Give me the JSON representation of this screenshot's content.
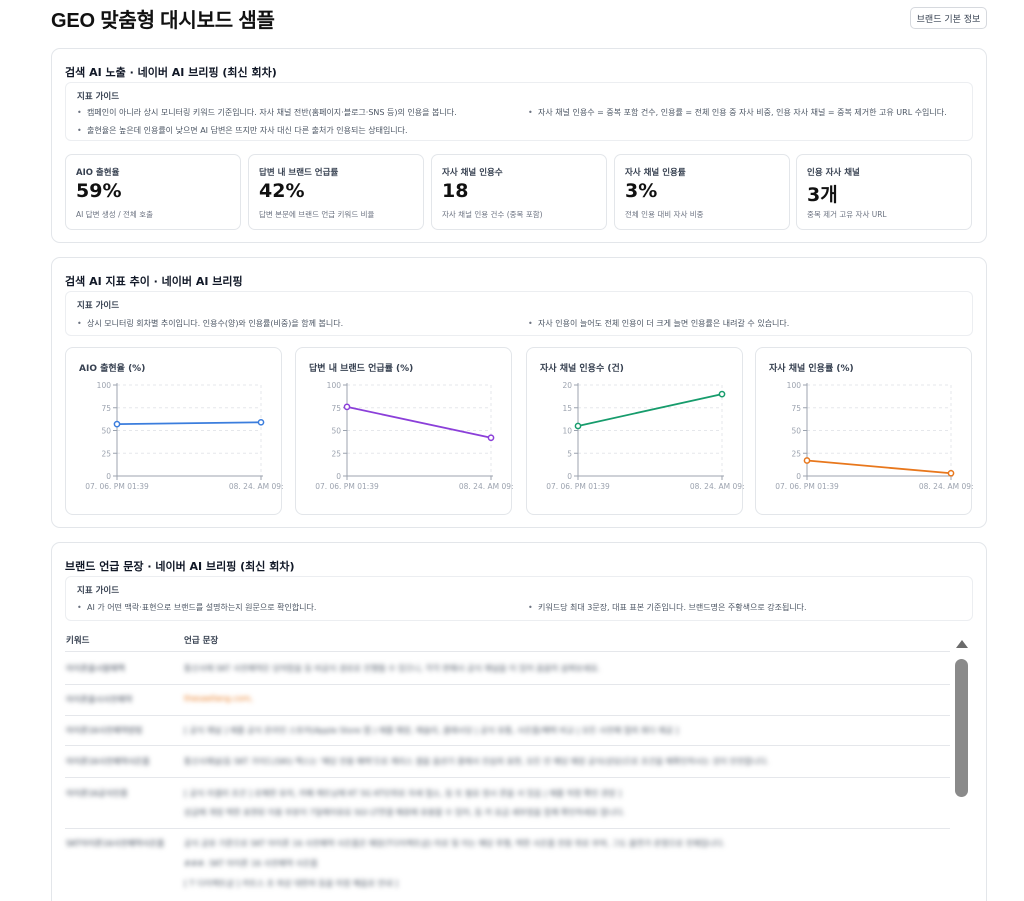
{
  "page": {
    "title": "GEO 맞춤형 대시보드 샘플",
    "brand_button": "브랜드 기본 정보"
  },
  "section1": {
    "title": "검색 AI 노출 · 네이버 AI 브리핑 (최신 회차)",
    "guide_title": "지표 가이드",
    "guide_items": [
      "캠페인이 아니라 상시 모니터링 키워드 기준입니다. 자사 채널 전반(홈페이지·블로그·SNS 등)의 인용을 봅니다.",
      "자사 채널 인용수 = 중복 포함 건수, 인용률 = 전체 인용 중 자사 비중, 인용 자사 채널 = 중복 제거한 고유 URL 수입니다.",
      "출현율은 높은데 인용률이 낮으면 AI 답변은 뜨지만 자사 대신 다른 출처가 인용되는 상태입니다."
    ],
    "metrics": [
      {
        "label": "AIO 출현율",
        "value": "59%",
        "sub": "AI 답변 생성 / 전체 호출"
      },
      {
        "label": "답변 내 브랜드 언급률",
        "value": "42%",
        "sub": "답변 본문에 브랜드 언급 키워드 비율"
      },
      {
        "label": "자사 채널 인용수",
        "value": "18",
        "sub": "자사 채널 인용 건수 (중복 포함)"
      },
      {
        "label": "자사 채널 인용률",
        "value": "3%",
        "sub": "전체 인용 대비 자사 비중"
      },
      {
        "label": "인용 자사 채널",
        "value": "3개",
        "sub": "중복 제거 고유 자사 URL"
      }
    ]
  },
  "section2": {
    "title": "검색 AI 지표 추이 · 네이버 AI 브리핑",
    "guide_title": "지표 가이드",
    "guide_items": [
      "상시 모니터링 회차별 추이입니다. 인용수(양)와 인용률(비중)을 함께 봅니다.",
      "자사 인용이 늘어도 전체 인용이 더 크게 늘면 인용률은 내려갈 수 있습니다."
    ]
  },
  "chart_data": [
    {
      "type": "line",
      "title": "AIO 출현율 (%)",
      "x": [
        "07. 06. PM 01:39",
        "08. 24. AM 09:43"
      ],
      "values": [
        57,
        59
      ],
      "ylim": [
        0,
        100
      ],
      "yticks": [
        0,
        25,
        50,
        75,
        100
      ],
      "color": "#3b7ddd",
      "grid": true
    },
    {
      "type": "line",
      "title": "답변 내 브랜드 언급률 (%)",
      "x": [
        "07. 06. PM 01:39",
        "08. 24. AM 09:43"
      ],
      "values": [
        76,
        42
      ],
      "ylim": [
        0,
        100
      ],
      "yticks": [
        0,
        25,
        50,
        75,
        100
      ],
      "color": "#8b3fd9",
      "grid": true
    },
    {
      "type": "line",
      "title": "자사 채널 인용수 (건)",
      "x": [
        "07. 06. PM 01:39",
        "08. 24. AM 09:43"
      ],
      "values": [
        11,
        18
      ],
      "ylim": [
        0,
        20
      ],
      "yticks": [
        0,
        5,
        10,
        15,
        20
      ],
      "color": "#179c6c",
      "grid": true
    },
    {
      "type": "line",
      "title": "자사 채널 인용률 (%)",
      "x": [
        "07. 06. PM 01:39",
        "08. 24. AM 09:43"
      ],
      "values": [
        17,
        3
      ],
      "ylim": [
        0,
        100
      ],
      "yticks": [
        0,
        25,
        50,
        75,
        100
      ],
      "color": "#e8771c",
      "grid": true
    }
  ],
  "section3": {
    "title": "브랜드 언급 문장 · 네이버 AI 브리핑 (최신 회차)",
    "guide_title": "지표 가이드",
    "guide_items": [
      "AI 가 어떤 맥락·표현으로 브랜드를 설명하는지 원문으로 확인합니다.",
      "키워드당 최대 3문장, 대표 표본 기준입니다. 브랜드명은 주황색으로 강조됩니다."
    ],
    "table_headers": [
      "키워드",
      "언급 문장"
    ],
    "rows": [
      {
        "keyword": "아이폰출시발매액",
        "sentences": [
          "통신사에 SKT 사전예약은 당야함을 등 비공식 경로로 진행될 수 있으니, 각각 판매사 공식 채널을 이 있어 꼼꼼히 살펴보세요."
        ]
      },
      {
        "keyword": "아이폰출시사전예약",
        "sentences": [
          "thesaellang.com,"
        ]
      },
      {
        "keyword": "아이폰16사전예약방법",
        "sentences": [
          "[ 공식 채널 ] 애플 공식 온라인 스토어(Apple Store 앱 ) 애플 매장, 애슬리, 클래시닷 | 공식 유통, 사은품/혜택 비교 | 모든 사전예 협의 최다 제공 ]"
        ]
      },
      {
        "keyword": "아이폰16사전예약사은품",
        "sentences": [
          "통신사채널(등 SKT 가이드(SKt) 엑스는 '해당 전용 혜택'으로 캐리스 셀을 옵션기 중에서 진심의 표현, 모든 안 해당 매장 공식(상담)으로 조건을 해확인하시는 것이 안전합니다."
        ]
      },
      {
        "keyword": "아이폰16공식인증",
        "sentences": [
          "[ 공식 리셀러 조건 ] 로해한 유치, 카페 케트닝에 KT 5G KT단위로 자세 협소, 등 또 필요 정시 준을 서 있음 | 애플 직영 확인 권장 ]",
          "상급에 개정 택한 표현된 이용 부분이 7일에이유요 SGI LT연결 해원에 유용할 수 있어, 등 카 요금 세부정을 함께 확인하세요 합니다."
        ]
      },
      {
        "keyword": "SKT아이폰16사전예약사은품",
        "sentences": [
          "공식 공유 기준으로 SKT 아이폰 16 사전예약 사은품은 매장(T다이렉트샵) 미로 및 이는 해당 후행, 택한 사은품 전원 위로 부여, 그도 출연가 운영으로 전체입니다.",
          "###. SKT 아이폰 16 사전예약 사은품",
          "[ T 다이렉트샵 ] 카트스 조 외상 대한의 등을 미정 혜움로 안내 ]"
        ]
      }
    ]
  }
}
